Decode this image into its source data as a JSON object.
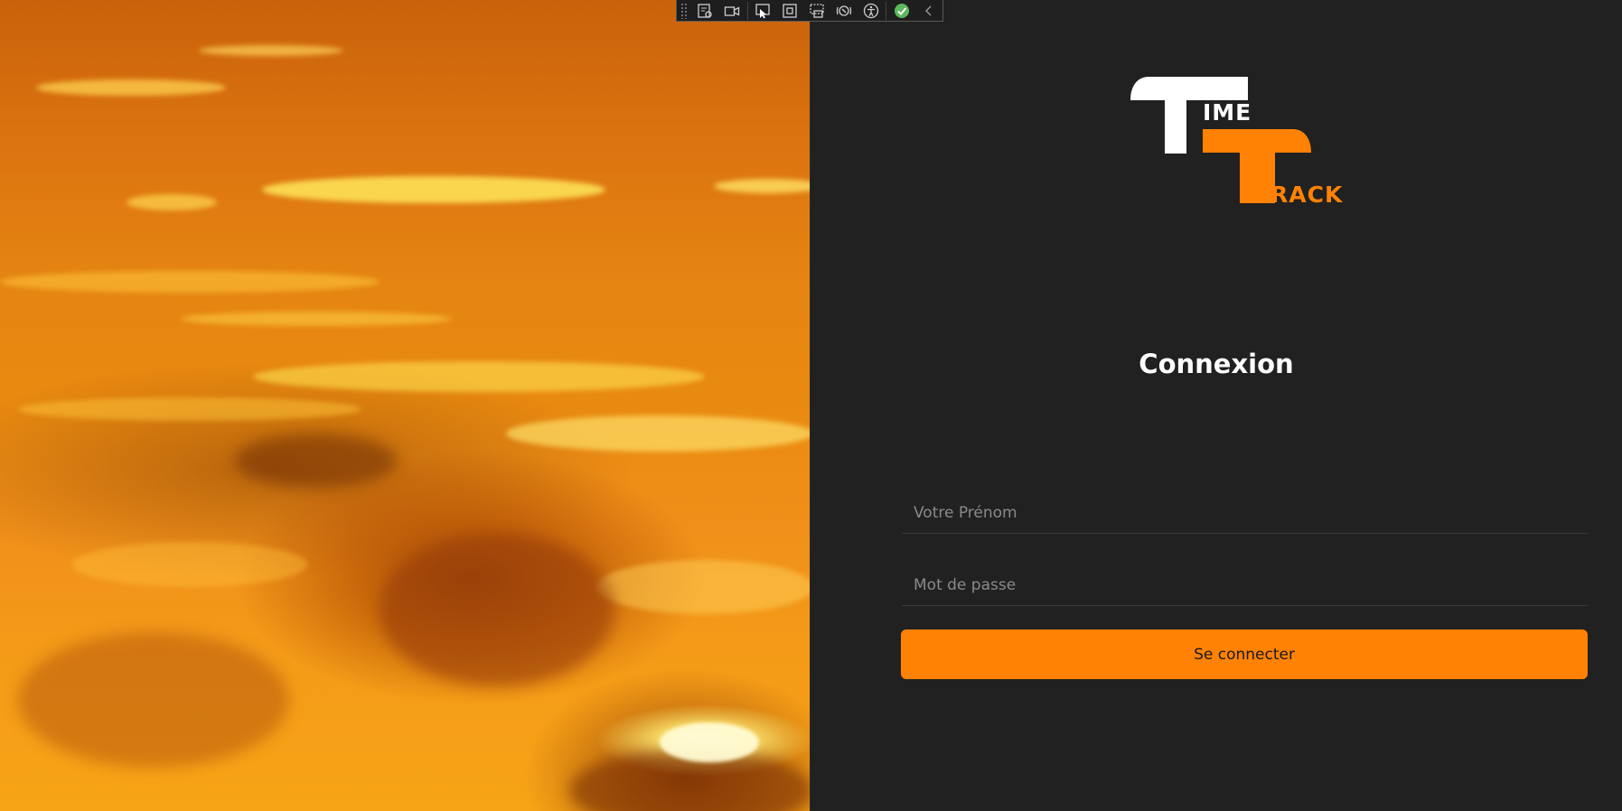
{
  "colors": {
    "accent": "#ff8205",
    "panel_background": "#212121",
    "logo_white": "#ffffff"
  },
  "hero": {
    "image": "sunset-clouds-photo"
  },
  "logo": {
    "brand_line1": "IME",
    "brand_line2": "RACK"
  },
  "login": {
    "title": "Connexion",
    "first_name_placeholder": "Votre Prénom",
    "password_placeholder": "Mot de passe",
    "submit_label": "Se connecter"
  },
  "toolbar": {
    "icons": [
      "live-visual-tree-icon",
      "record-icon",
      "select-element-icon",
      "display-layout-adorners-icon",
      "track-focus-icon",
      "binding-failures-icon",
      "accessibility-icon",
      "hot-reload-ok-icon",
      "collapse-chevron-icon"
    ]
  }
}
